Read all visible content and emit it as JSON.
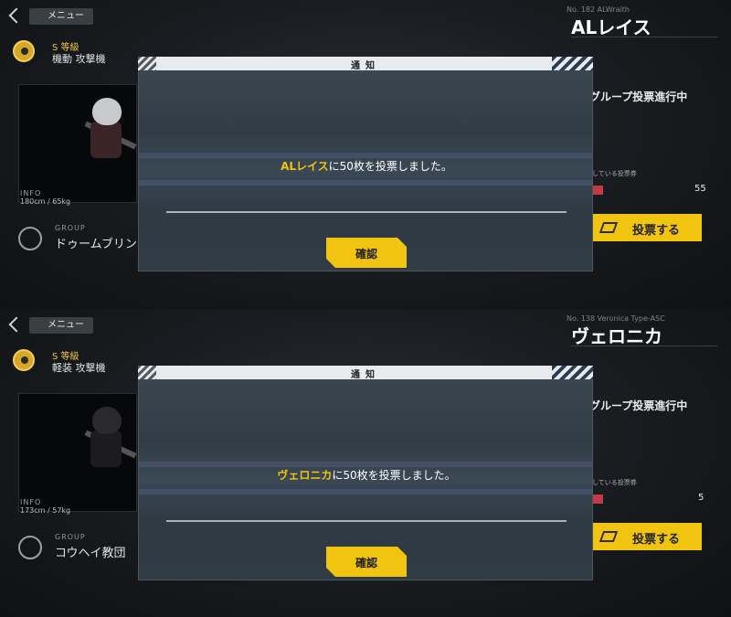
{
  "panels": [
    {
      "menu_label": "メニュー",
      "rank": "S 等級",
      "class": "機動 攻撃機",
      "info_label": "INFO",
      "info_value": "180cm  / 65kg",
      "group_label": "GROUP",
      "group_name": "ドゥームブリンガー",
      "char_number": "No. 182  ALWraith",
      "char_name": "ALレイス",
      "vote_status": "グループ投票進行中",
      "holding_label": "している投票券",
      "vote_count": "55",
      "vote_button": "投票する",
      "dialog": {
        "title": "通知",
        "highlight": "ALレイス",
        "message_rest": "に50枚を投票しました。",
        "confirm": "確認"
      }
    },
    {
      "menu_label": "メニュー",
      "rank": "S 等級",
      "class": "軽装 攻撃機",
      "info_label": "INFO",
      "info_value": "173cm  / 57kg",
      "group_label": "GROUP",
      "group_name": "コウヘイ教団",
      "char_number": "No. 138  Veronica Type-ASC",
      "char_name": "ヴェロニカ",
      "vote_status": "グループ投票進行中",
      "holding_label": "している投票券",
      "vote_count": "5",
      "vote_button": "投票する",
      "dialog": {
        "title": "通知",
        "highlight": "ヴェロニカ",
        "message_rest": "に50枚を投票しました。",
        "confirm": "確認"
      }
    }
  ],
  "colors": {
    "accent": "#f1c40f",
    "dialog_bg": "#34404a",
    "header_bg": "#e8ebee"
  }
}
